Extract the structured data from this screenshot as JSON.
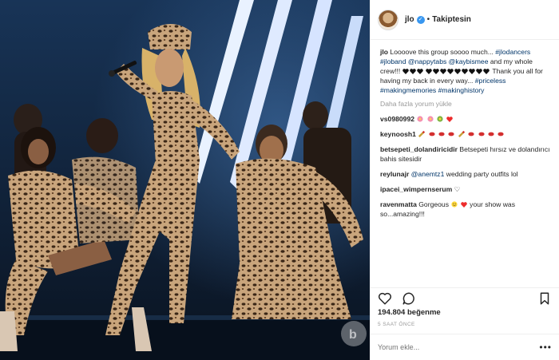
{
  "header": {
    "username": "jlo",
    "separator": "•",
    "follow_status": "Takiptesin"
  },
  "caption": {
    "username": "jlo",
    "text_1": "Loooove this group soooo much...",
    "tag_jlodancers": "#jlodancers",
    "tag_jloband": "#jloband",
    "tag_nappytabs": "@nappytabs",
    "tag_kaybismee": "@kaybismee",
    "text_2": "and my whole crew!!!",
    "text_3": "Thank you all for having my back in every way...",
    "tag_priceless": "#priceless",
    "tag_makingmemories": "#makingmemories",
    "tag_makinghistory": "#makinghistory"
  },
  "load_more": "Daha fazla yorum yükle",
  "comments": [
    {
      "username": "vs0980992",
      "text": ""
    },
    {
      "username": "keynoosh1",
      "text": ""
    },
    {
      "username": "betsepeti_dolandiricidir",
      "text": "Betsepeti hırsız ve dolandırıcı bahis sitesidir"
    },
    {
      "username": "reylunajr",
      "mention": "@anemtz1",
      "text": "wedding party outfits lol"
    },
    {
      "username": "ipacei_wimpernserum",
      "text": "♡"
    },
    {
      "username": "ravenmatta",
      "text": "Gorgeous",
      "text_after": "your show was so...amazing!!!"
    }
  ],
  "likes": "194.804 beğenme",
  "time_ago": "5 SAAT ÖNCE",
  "comment_input": {
    "placeholder": "Yorum ekle..."
  },
  "more_options": "•••",
  "icons": {
    "verified": "verified-badge-icon",
    "like": "heart-outline-icon",
    "comment": "comment-bubble-icon",
    "save": "bookmark-icon"
  },
  "colors": {
    "link": "#003569",
    "verified": "#3897f0",
    "muted": "#999999",
    "heart_red": "#ed2c2c"
  }
}
